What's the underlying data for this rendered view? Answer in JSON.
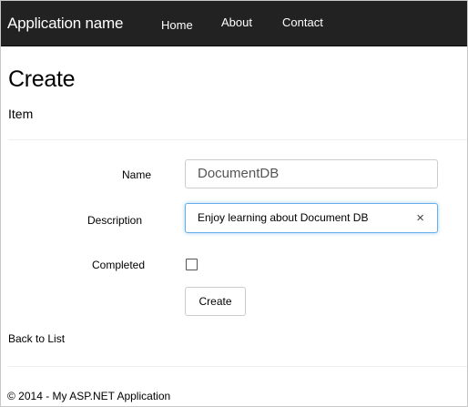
{
  "navbar": {
    "brand": "Application name",
    "links": [
      {
        "label": "Home"
      },
      {
        "label": "About"
      },
      {
        "label": "Contact"
      }
    ]
  },
  "page": {
    "title": "Create",
    "subtitle": "Item"
  },
  "form": {
    "name_label": "Name",
    "name_value": "DocumentDB",
    "description_label": "Description",
    "description_value": "Enjoy learning about Document DB",
    "clear_icon": "×",
    "completed_label": "Completed",
    "completed_checked": false,
    "submit_label": "Create"
  },
  "back_link": "Back to List",
  "footer": "© 2014 - My ASP.NET Application",
  "colors": {
    "navbar_bg": "#222222",
    "focus_border": "#66afe9"
  }
}
